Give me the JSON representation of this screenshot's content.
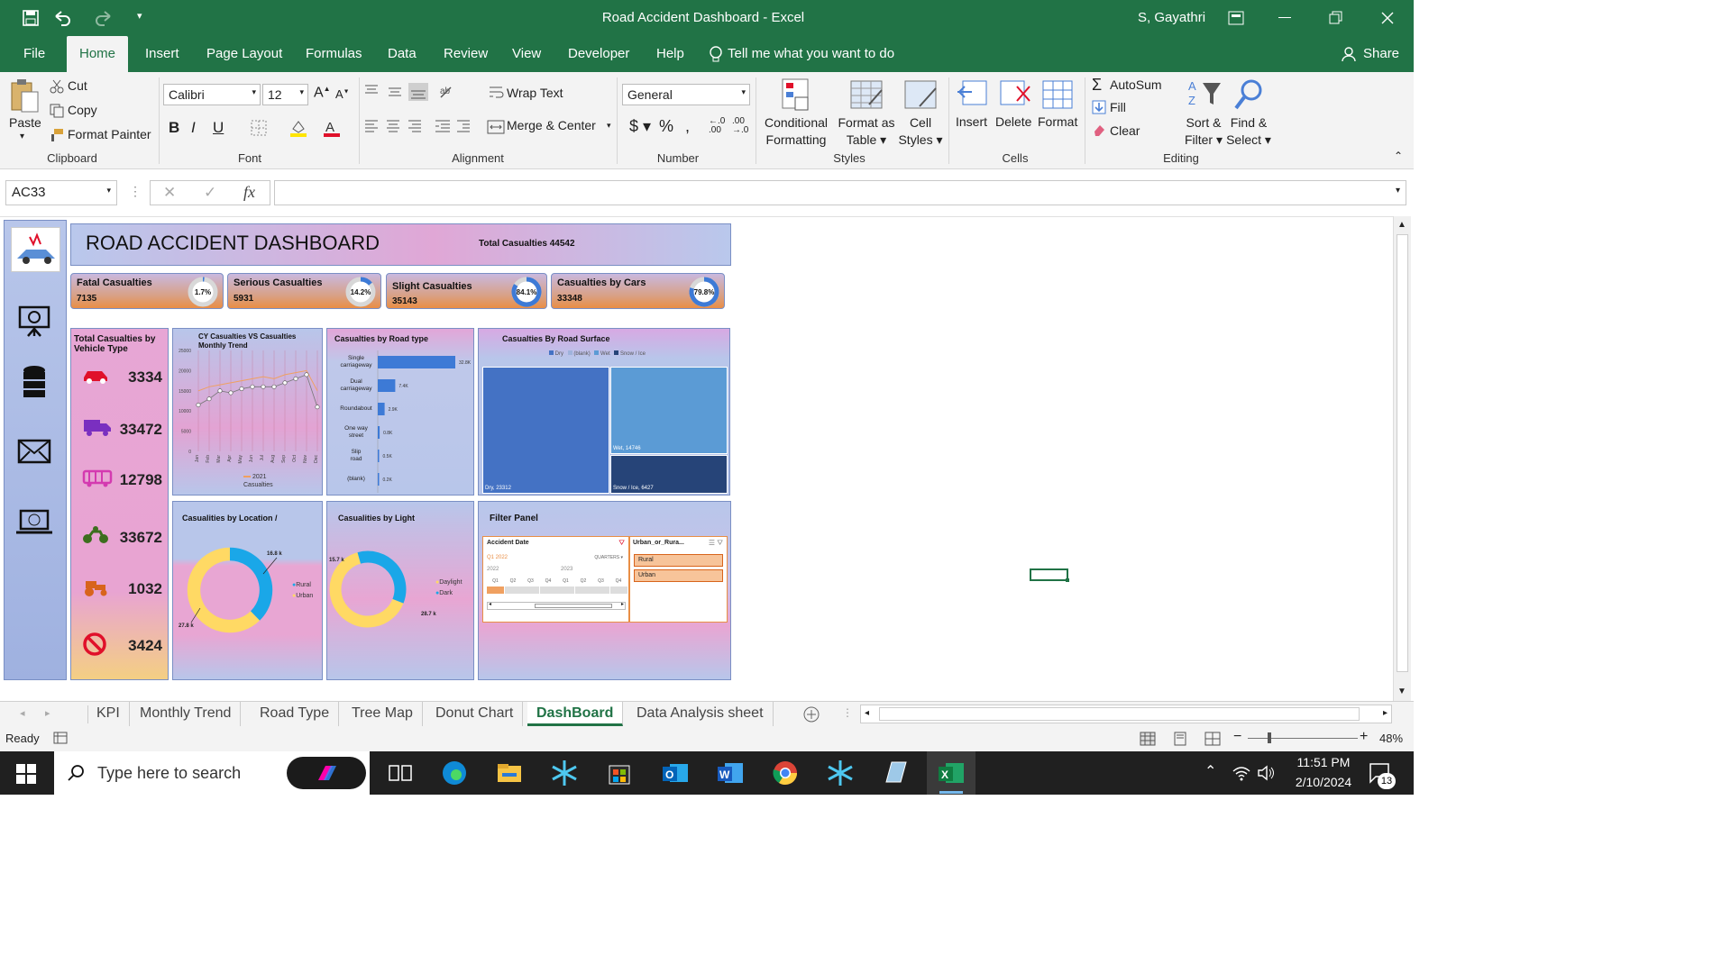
{
  "window": {
    "title": "Road Accident Dashboard  -  Excel",
    "user": "S, Gayathri"
  },
  "ribbon_tabs": [
    "File",
    "Home",
    "Insert",
    "Page Layout",
    "Formulas",
    "Data",
    "Review",
    "View",
    "Developer",
    "Help"
  ],
  "tell_me": "Tell me what you want to do",
  "share": "Share",
  "clipboard": {
    "paste": "Paste",
    "cut": "Cut",
    "copy": "Copy",
    "format_painter": "Format Painter",
    "label": "Clipboard"
  },
  "font": {
    "name": "Calibri",
    "size": "12",
    "label": "Font"
  },
  "alignment": {
    "wrap": "Wrap Text",
    "merge": "Merge & Center",
    "label": "Alignment"
  },
  "number": {
    "format": "General",
    "label": "Number"
  },
  "styles": {
    "cond": "Conditional",
    "cond2": "Formatting",
    "fmt_table": "Format as",
    "fmt_table2": "Table",
    "cell_styles": "Cell",
    "cell_styles2": "Styles",
    "label": "Styles"
  },
  "cells": {
    "insert": "Insert",
    "delete": "Delete",
    "format": "Format",
    "label": "Cells"
  },
  "editing": {
    "autosum": "AutoSum",
    "fill": "Fill",
    "clear": "Clear",
    "sort": "Sort &",
    "sort2": "Filter",
    "find": "Find &",
    "find2": "Select",
    "label": "Editing"
  },
  "name_box": "AC33",
  "sheet_tabs": [
    "KPI",
    "Monthly Trend",
    "Road Type",
    "Tree Map",
    "Donut Chart",
    "DashBoard",
    "Data Analysis sheet"
  ],
  "active_tab": "DashBoard",
  "status": {
    "ready": "Ready",
    "zoom": "48%"
  },
  "taskbar": {
    "search": "Type here to search",
    "time": "11:51 PM",
    "date": "2/10/2024",
    "notif": "13"
  },
  "dashboard": {
    "title": "ROAD ACCIDENT DASHBOARD",
    "total": "Total Casualties 44542",
    "kpis": [
      {
        "label": "Fatal Casualties",
        "value": "7135",
        "pct": "1.7%",
        "fraction": 0.017
      },
      {
        "label": "Serious Casualties",
        "value": "5931",
        "pct": "14.2%",
        "fraction": 0.142
      },
      {
        "label": "Slight Casualties",
        "value": "35143",
        "pct": "84.1%",
        "fraction": 0.841
      },
      {
        "label": "Casualties by Cars",
        "value": "33348",
        "pct": "79.8%",
        "fraction": 0.798
      }
    ],
    "vehicle_title": "Total Casualties by Vehicle Type",
    "vehicles": [
      {
        "icon": "car-icon",
        "value": "3334",
        "color": "#e0102a"
      },
      {
        "icon": "truck-icon",
        "value": "33472",
        "color": "#7a2fc0"
      },
      {
        "icon": "bus-icon",
        "value": "12798",
        "color": "#d43ab0"
      },
      {
        "icon": "motorbike-icon",
        "value": "33672",
        "color": "#3c6e1e"
      },
      {
        "icon": "tractor-icon",
        "value": "1032",
        "color": "#d8641c"
      },
      {
        "icon": "no-entry-icon",
        "value": "3424",
        "color": "#e0102a"
      }
    ],
    "trend_title": "CY Casualties  VS  Casualties Monthly Trend",
    "trend_legend": "2021 Casualties",
    "road_title": "Casualties by Road type",
    "road_surface_title": "Casualties By Road Surface",
    "road_surface_legend": [
      "Dry",
      "(blank)",
      "Wet",
      "Snow / Ice"
    ],
    "road_surface_labels": [
      "Dry, 23312",
      "Wet, 14746",
      "Snow / Ice, 6427"
    ],
    "location_title": "Casualities by Location /",
    "location_labels": [
      "16.8 k",
      "27.8 k"
    ],
    "location_legend": [
      "Rural",
      "Urban"
    ],
    "light_title": "Casualities by Light",
    "light_labels": [
      "15.7 k",
      "28.7 k"
    ],
    "light_legend": [
      "Daylight",
      "Dark"
    ],
    "filter_title": "Filter Panel",
    "filter_date": "Accident Date",
    "filter_q": "Q1 2022",
    "filter_quarters": "QUARTERS",
    "filter_years": [
      "2022",
      "2023"
    ],
    "filter_qs": [
      "Q1",
      "Q2",
      "Q3",
      "Q4",
      "Q1",
      "Q2",
      "Q3",
      "Q4"
    ],
    "filter_urban": "Urban_or_Rura...",
    "filter_opts": [
      "Rural",
      "Urban"
    ]
  },
  "chart_data": [
    {
      "type": "line",
      "title": "CY Casualties  VS  Casualties Monthly Trend",
      "x": [
        "Jan",
        "Feb",
        "Mar",
        "Apr",
        "May",
        "Jun",
        "Jul",
        "Aug",
        "Sep",
        "Oct",
        "Nov",
        "Dec"
      ],
      "series": [
        {
          "name": "2021 Casualties",
          "values": [
            11500,
            13000,
            15000,
            14500,
            15500,
            16000,
            16000,
            16000,
            17000,
            18000,
            19000,
            11000
          ]
        },
        {
          "values": [
            15000,
            16000,
            16500,
            17000,
            17500,
            18000,
            18500,
            18000,
            19000,
            19500,
            20000,
            15000
          ]
        }
      ],
      "ylim": [
        0,
        25000
      ],
      "yticks": [
        "25000",
        "20000",
        "15000",
        "10000",
        "5000",
        "0"
      ]
    },
    {
      "type": "bar",
      "title": "Casualties by Road type",
      "categories": [
        "Single carriageway",
        "Dual carriageway",
        "Roundabout",
        "One way street",
        "Slip road",
        "(blank)"
      ],
      "values": [
        32800,
        7400,
        2900,
        800,
        500,
        200
      ],
      "labels": [
        "32.8K",
        "7.4K",
        "2.9K",
        "0.8K",
        "0.5K",
        "0.2K"
      ]
    },
    {
      "type": "heatmap",
      "title": "Casualties By Road Surface",
      "categories": [
        "Dry",
        "Wet",
        "Snow / Ice"
      ],
      "values": [
        23312,
        14746,
        6427
      ]
    },
    {
      "type": "pie",
      "title": "Casualities by Location /",
      "categories": [
        "Rural",
        "Urban"
      ],
      "values": [
        16800,
        27800
      ]
    },
    {
      "type": "pie",
      "title": "Casualities by Light",
      "categories": [
        "Daylight",
        "Dark"
      ],
      "values": [
        28700,
        15700
      ]
    }
  ]
}
